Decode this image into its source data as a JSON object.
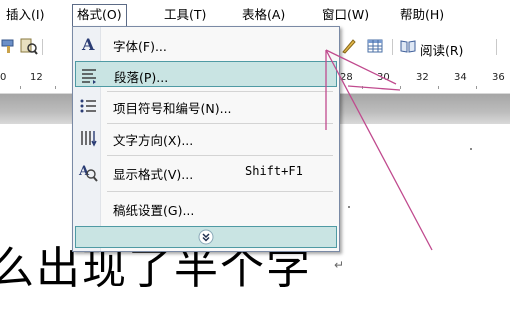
{
  "menubar": {
    "items": [
      {
        "label": "插入(I)"
      },
      {
        "label": "格式(O)"
      },
      {
        "label": "工具(T)"
      },
      {
        "label": "表格(A)"
      },
      {
        "label": "窗口(W)"
      },
      {
        "label": "帮助(H)"
      }
    ]
  },
  "toolbar": {
    "read_label": "阅读(R)"
  },
  "ruler": {
    "ticks": [
      "0",
      "12",
      "28",
      "30",
      "32",
      "34",
      "36"
    ]
  },
  "format_menu": {
    "items": [
      {
        "label": "字体(F)...",
        "icon": "font-a-icon",
        "shortcut": ""
      },
      {
        "label": "段落(P)...",
        "icon": "paragraph-icon",
        "shortcut": "",
        "highlighted": true
      },
      {
        "label": "项目符号和编号(N)...",
        "icon": "bullets-icon",
        "shortcut": ""
      },
      {
        "label": "文字方向(X)...",
        "icon": "text-direction-icon",
        "shortcut": ""
      },
      {
        "label": "显示格式(V)...",
        "icon": "reveal-formatting-icon",
        "shortcut": "Shift+F1"
      },
      {
        "label": "稿纸设置(G)...",
        "icon": "",
        "shortcut": ""
      }
    ],
    "expand_icon": "double-chevron-down-icon"
  },
  "document": {
    "text": "么出现了半个字",
    "paragraph_mark": "↵"
  },
  "colors": {
    "highlight_fill": "#c9e4e3",
    "highlight_border": "#4f9aa4",
    "annotation_line": "#c04a8e"
  }
}
